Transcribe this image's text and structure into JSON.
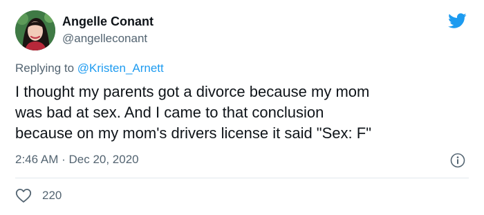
{
  "author": {
    "name": "Angelle Conant",
    "handle": "@angelleconant"
  },
  "reply": {
    "prefix": "Replying to ",
    "mention": "@Kristen_Arnett"
  },
  "tweet": {
    "lines": [
      "I thought my parents got a divorce because my mom",
      "was bad at sex. And I came to that conclusion",
      "because on my mom's drivers license it said \"Sex: F\""
    ]
  },
  "meta": {
    "time": "2:46 AM",
    "separator": " · ",
    "date": "Dec 20, 2020"
  },
  "engagement": {
    "likes": "220"
  },
  "icons": {
    "logo": "twitter-bird-icon",
    "info": "info-icon",
    "like": "heart-icon"
  },
  "colors": {
    "brand": "#1d9bf0",
    "text": "#0f1419",
    "secondary": "#536471",
    "divider": "#e1e8ed"
  }
}
